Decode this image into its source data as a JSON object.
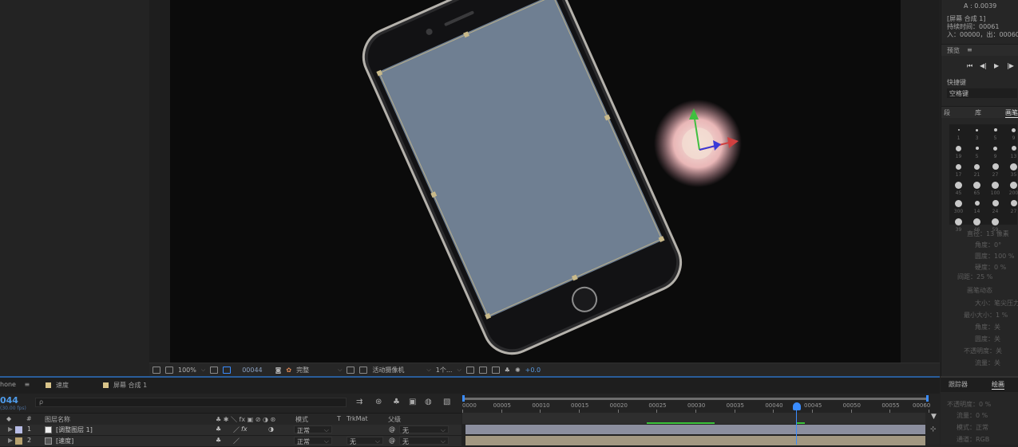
{
  "comp": {
    "zoom": "100%",
    "timecode": "00044",
    "quality": "完整",
    "camera": "活动摄像机",
    "views": "1个...",
    "exposure": "+0.0"
  },
  "right_panel": {
    "a_value": "A : 0.0039",
    "info_lines": [
      "[屏幕 合成 1]",
      "持续时间：00061",
      "入：00000，出：00060"
    ],
    "preview_title": "预览",
    "shortcut_label": "快捷键",
    "shortcut_value": "空格键",
    "brush_tabs": [
      "段",
      "库",
      "画笔"
    ],
    "brush_sizes": [
      "1",
      "3",
      "5",
      "9",
      "19",
      "5",
      "9",
      "13",
      "17",
      "21",
      "27",
      "35",
      "45",
      "65",
      "100",
      "200",
      "300",
      "14",
      "24",
      "27",
      "39",
      "46",
      "59"
    ],
    "brush_props": [
      "直径：13 像素",
      "角度：0°",
      "圆度：100 %",
      "硬度：0 %",
      "间距：25 %",
      "画笔动态",
      "大小：笔尖压力",
      "最小大小：1 %",
      "角度：关",
      "圆度：关",
      "不透明度：关",
      "流量：关"
    ],
    "bottom_tabs": [
      "跟踪器",
      "绘画"
    ],
    "paint_props": [
      "不透明度：0 %",
      "流量：0 %",
      "模式：正常",
      "通道：RGB"
    ]
  },
  "timeline": {
    "tabs": [
      {
        "label": "hone",
        "color": "#9ea7c2"
      },
      {
        "label": "速度",
        "color": "#d9c48a"
      },
      {
        "label": "屏幕 合成 1",
        "color": "#d9c48a"
      }
    ],
    "current_time": "044",
    "fps": "(30.00 fps)",
    "search_placeholder": "ρ",
    "columns": {
      "name": "图层名称",
      "mode": "模式",
      "t": "T",
      "trkmat": "TrkMat",
      "parent": "父级"
    },
    "layers": [
      {
        "num": "1",
        "name": "[调整图层 1]",
        "color": "#b8bde6",
        "mode": "正常",
        "trkmat": "",
        "parent": "无"
      },
      {
        "num": "2",
        "name": "[速度]",
        "color": "#b8a270",
        "mode": "正常",
        "trkmat": "无",
        "parent": "无"
      }
    ],
    "ruler_labels": [
      "0000",
      "00005",
      "00010",
      "00015",
      "00020",
      "00025",
      "00030",
      "00035",
      "00040",
      "00045",
      "00050",
      "00055",
      "00060"
    ]
  },
  "colors": {
    "accent": "#2f7ed8",
    "phone_screen": "#6f7f92",
    "adjustment_layer_bar": "#8c8f9f",
    "speed_layer_bar": "#a39882"
  }
}
